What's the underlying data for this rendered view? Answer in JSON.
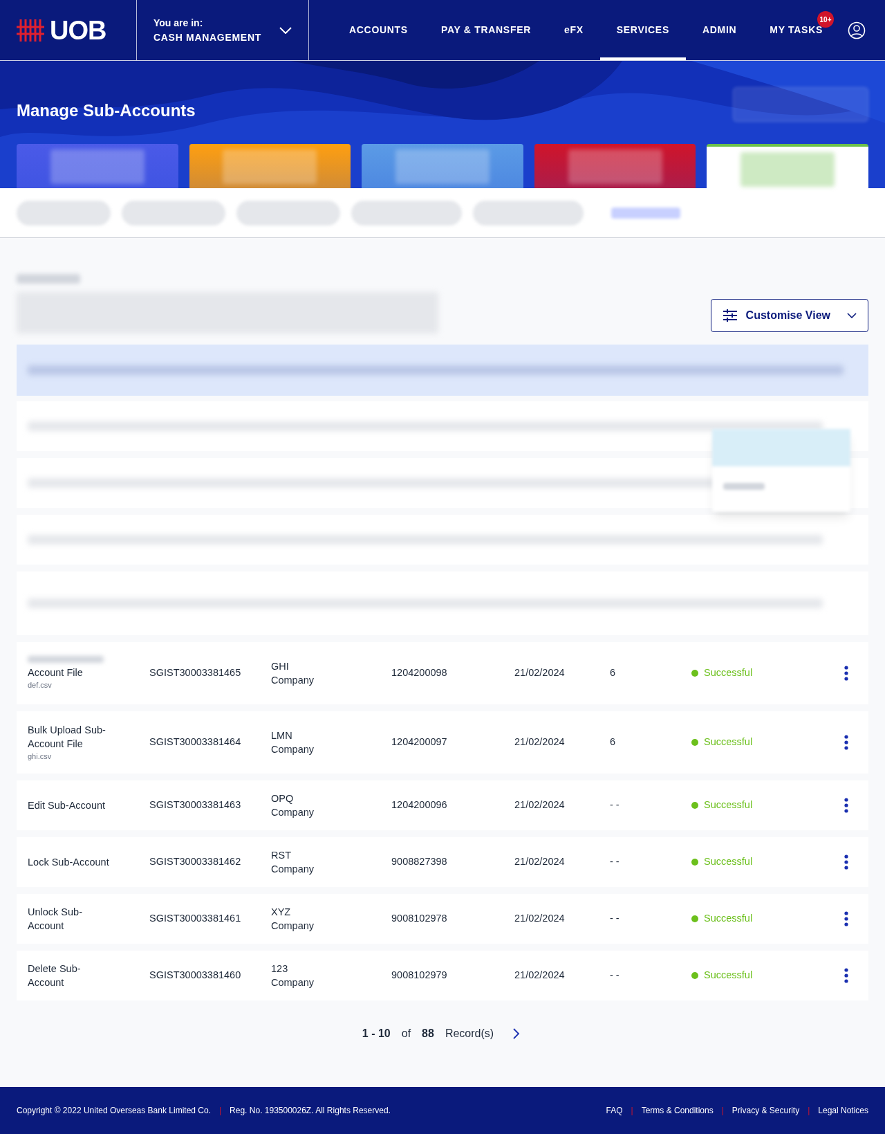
{
  "header": {
    "logo": "UOB",
    "context_label": "You are in:",
    "context_value": "CASH MANAGEMENT",
    "nav": [
      {
        "label": "ACCOUNTS",
        "selected": false
      },
      {
        "label": "PAY & TRANSFER",
        "selected": false
      },
      {
        "label": "eFX",
        "selected": false
      },
      {
        "label": "SERVICES",
        "selected": true
      },
      {
        "label": "ADMIN",
        "selected": false
      },
      {
        "label": "MY TASKS",
        "selected": false,
        "badge": "10+"
      }
    ]
  },
  "page_title": "Manage Sub-Accounts",
  "status_tabs": [
    {
      "color": "#4a5ae8",
      "selected": false
    },
    {
      "color": "#ff9f10",
      "selected": false
    },
    {
      "color": "#5b9be6",
      "selected": false
    },
    {
      "color": "#d0142a",
      "selected": false
    },
    {
      "color": "#6cc04a",
      "selected": true
    }
  ],
  "customise_view": "Customise View",
  "rows": [
    {
      "kind": "hidden"
    },
    {
      "kind": "hidden"
    },
    {
      "kind": "hidden"
    },
    {
      "kind": "hidden"
    },
    {
      "kind": "partial",
      "request_type": "Account File",
      "file": "def.csv",
      "bank_reference": "SGIST30003381465",
      "account_name": "GHI Company",
      "account_number": "1204200098",
      "submission_date": "21/02/2024",
      "records": "6",
      "status": "Successful",
      "color": "#6cc01c"
    },
    {
      "kind": "full",
      "request_type": "Bulk Upload Sub-Account File",
      "file": "ghi.csv",
      "bank_reference": "SGIST30003381464",
      "account_name": "LMN Company",
      "account_number": "1204200097",
      "submission_date": "21/02/2024",
      "records": "6",
      "status": "Successful",
      "color": "#6cc01c"
    },
    {
      "kind": "full",
      "request_type": "Edit Sub-Account",
      "bank_reference": "SGIST30003381463",
      "account_name": "OPQ Company",
      "account_number": "1204200096",
      "submission_date": "21/02/2024",
      "records": "- -",
      "status": "Successful",
      "color": "#6cc01c"
    },
    {
      "kind": "full",
      "request_type": "Lock Sub-Account",
      "bank_reference": "SGIST30003381462",
      "account_name": "RST Company",
      "account_number": "9008827398",
      "submission_date": "21/02/2024",
      "records": "- -",
      "status": "Successful",
      "color": "#6cc01c"
    },
    {
      "kind": "full",
      "request_type": "Unlock Sub-Account",
      "bank_reference": "SGIST30003381461",
      "account_name": "XYZ Company",
      "account_number": "9008102978",
      "submission_date": "21/02/2024",
      "records": "- -",
      "status": "Successful",
      "color": "#6cc01c"
    },
    {
      "kind": "full",
      "request_type": "Delete Sub-Account",
      "bank_reference": "SGIST30003381460",
      "account_name": "123 Company",
      "account_number": "9008102979",
      "submission_date": "21/02/2024",
      "records": "- -",
      "status": "Successful",
      "color": "#6cc01c"
    }
  ],
  "pagination": {
    "range": "1 - 10",
    "of": "of",
    "total": "88",
    "unit": "Record(s)"
  },
  "footer": {
    "left": [
      {
        "kind": "text",
        "text": "Copyright © 2022 United Overseas Bank Limited Co."
      },
      {
        "kind": "separator",
        "text": "|"
      },
      {
        "kind": "text",
        "text": "Reg. No. 193500026Z. All Rights Reserved."
      }
    ],
    "links": [
      {
        "kind": "link",
        "text": "FAQ"
      },
      {
        "kind": "separator",
        "text": "|"
      },
      {
        "kind": "link",
        "text": "Terms & Conditions"
      },
      {
        "kind": "separator",
        "text": "|"
      },
      {
        "kind": "link",
        "text": "Privacy & Security"
      },
      {
        "kind": "separator",
        "text": "|"
      },
      {
        "kind": "link",
        "text": "Legal Notices"
      }
    ]
  }
}
